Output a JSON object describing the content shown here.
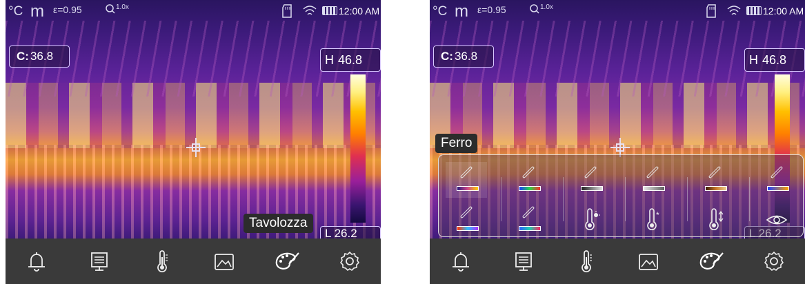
{
  "status_bar": {
    "unit": "°C",
    "mode": "m",
    "emissivity": "ε=0.95",
    "zoom": "1.0x",
    "time": "12:00 AM"
  },
  "left_screen": {
    "center_reading": {
      "prefix": "C:",
      "value": "36.8"
    },
    "high_reading": {
      "prefix": "H",
      "value": "46.8"
    },
    "low_reading": {
      "prefix": "L",
      "value": "26.2"
    },
    "tooltip": "Tavolozza"
  },
  "right_screen": {
    "center_reading": {
      "prefix": "C:",
      "value": "36.8"
    },
    "high_reading": {
      "prefix": "H",
      "value": "46.8"
    },
    "low_reading": {
      "prefix": "L",
      "value": "26.2"
    },
    "tooltip": "Ferro",
    "palette_options": [
      {
        "icon": "palette-iron-icon",
        "colors": [
          "#2a1b7c",
          "#d14a8a",
          "#ffd200"
        ]
      },
      {
        "icon": "palette-rainbow-icon",
        "colors": [
          "#1a3cff",
          "#2ad84a",
          "#ff2a2a"
        ]
      },
      {
        "icon": "palette-black-hot-icon",
        "colors": [
          "#202020",
          "#e0e0e0"
        ]
      },
      {
        "icon": "palette-white-hot-icon",
        "colors": [
          "#e8e8e8",
          "#606060"
        ]
      },
      {
        "icon": "palette-bronze-icon",
        "colors": [
          "#3a1a0a",
          "#c87a2a",
          "#f0d090"
        ]
      },
      {
        "icon": "palette-arctic-icon",
        "colors": [
          "#2040ff",
          "#ffa000"
        ]
      },
      {
        "icon": "palette-rainbow-hc-icon",
        "colors": [
          "#ff3000",
          "#30c0ff",
          "#b030ff"
        ]
      },
      {
        "icon": "palette-medical-icon",
        "colors": [
          "#3060ff",
          "#20d0b0",
          "#ff2060"
        ]
      },
      {
        "icon": "alarm-above-icon",
        "colors": []
      },
      {
        "icon": "alarm-below-icon",
        "colors": []
      },
      {
        "icon": "alarm-range-icon",
        "colors": []
      },
      {
        "icon": "visual-image-icon",
        "colors": []
      }
    ]
  },
  "bottom_nav": [
    {
      "icon": "bell-icon"
    },
    {
      "icon": "monitor-icon"
    },
    {
      "icon": "thermometer-icon"
    },
    {
      "icon": "image-icon"
    },
    {
      "icon": "palette-icon"
    },
    {
      "icon": "gear-icon"
    }
  ],
  "colors": {
    "bottom_bar": "#3a3a3a",
    "tooltip_bg": "#2c2c2c",
    "border": "#d8c8ff"
  }
}
